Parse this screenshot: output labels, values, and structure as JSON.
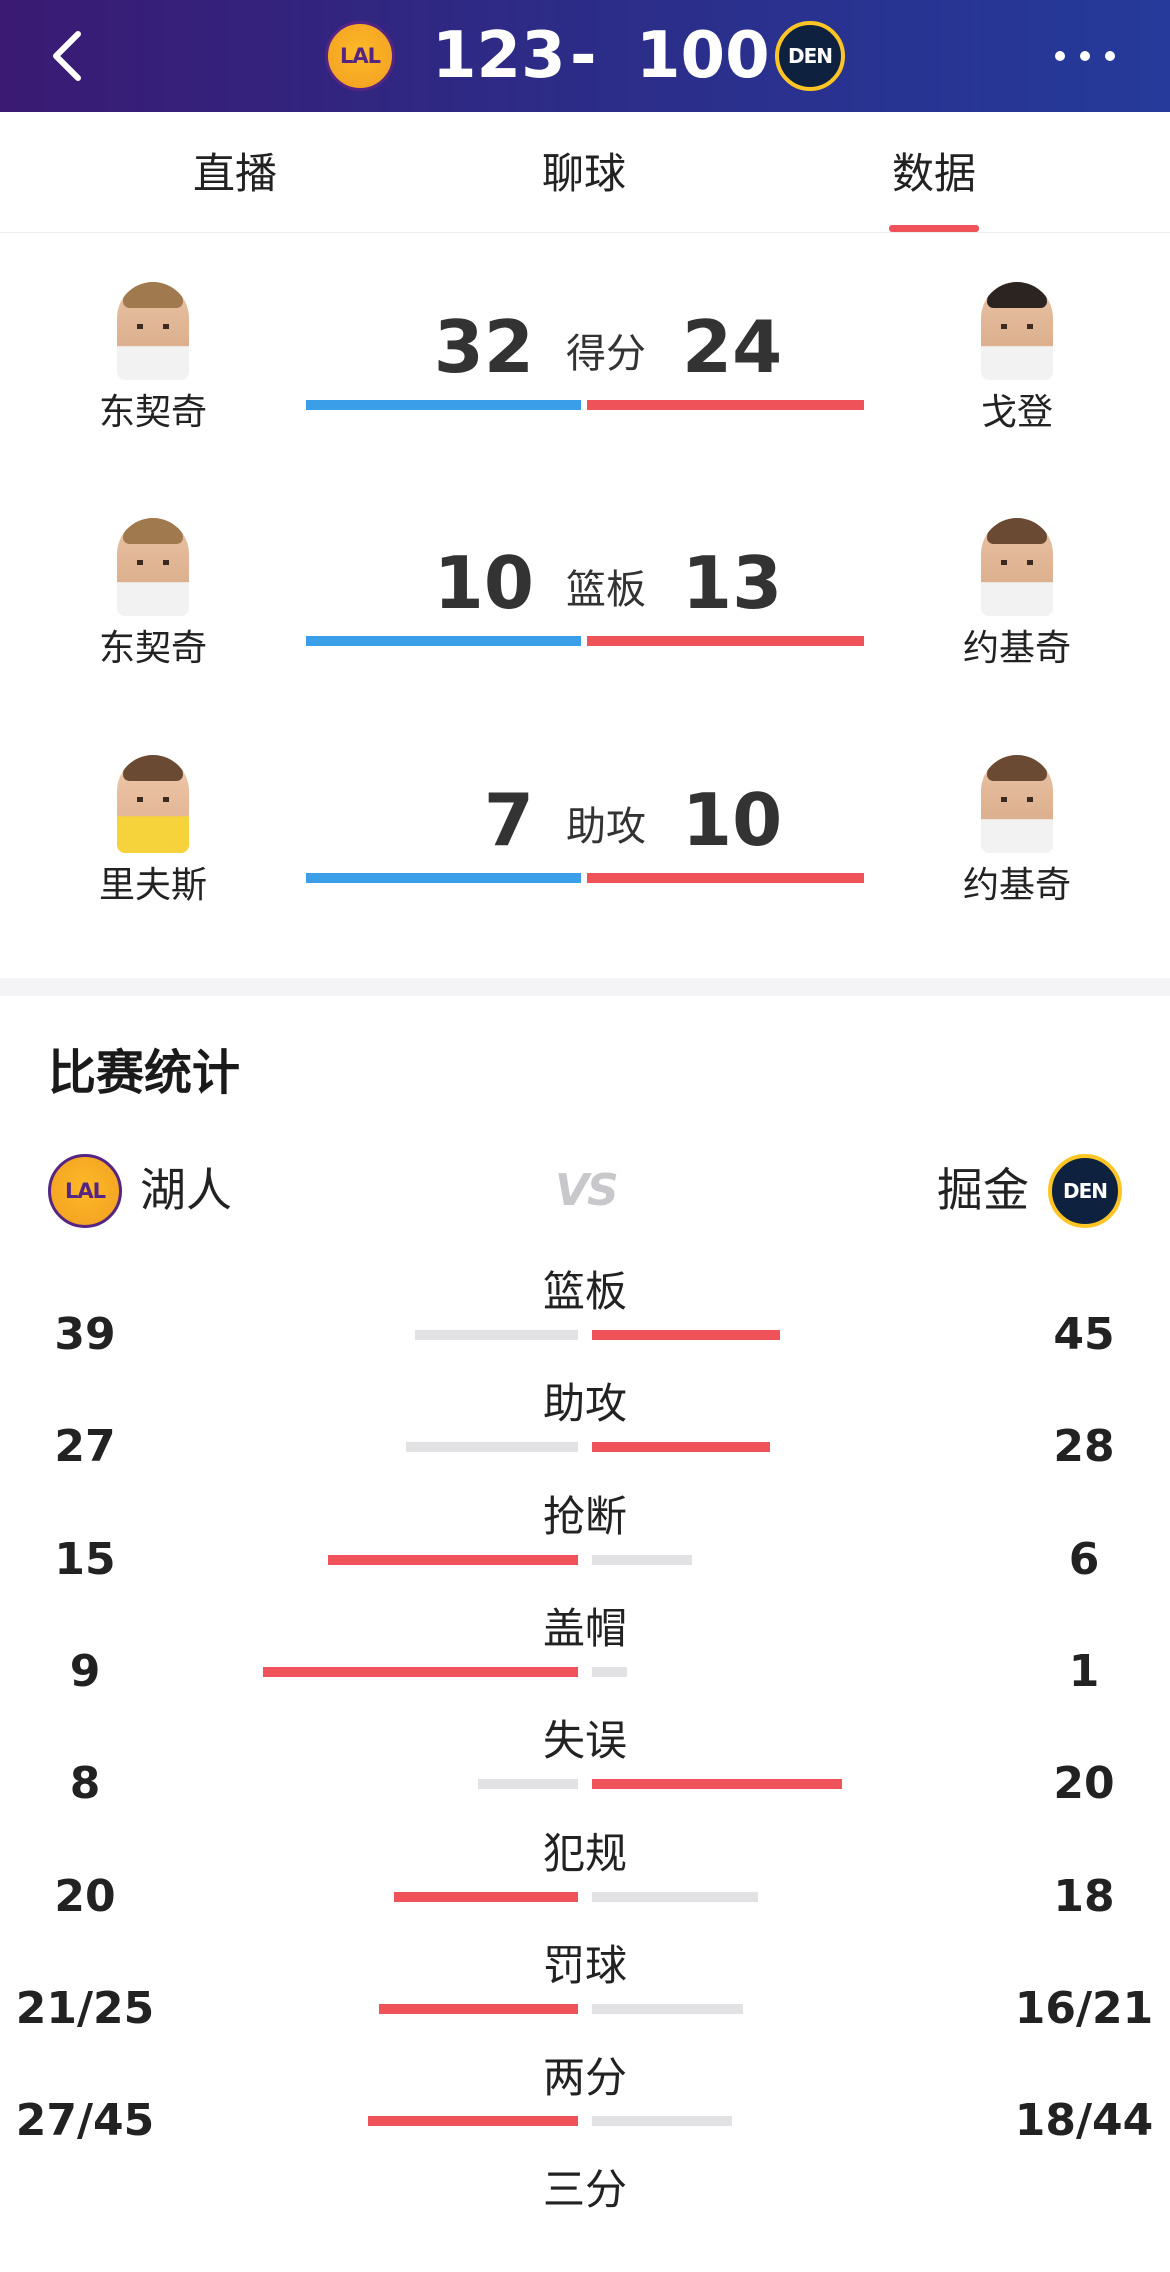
{
  "header": {
    "home_score": "123",
    "separator": "-",
    "away_score": "100",
    "home_logo_text": "LAL",
    "away_logo_text": "DEN"
  },
  "tabs": [
    {
      "label": "直播",
      "active": false
    },
    {
      "label": "聊球",
      "active": false
    },
    {
      "label": "数据",
      "active": true
    }
  ],
  "leaders": [
    {
      "category": "得分",
      "home_value": "32",
      "away_value": "24",
      "home_player": "东契奇",
      "away_player": "戈登"
    },
    {
      "category": "篮板",
      "home_value": "10",
      "away_value": "13",
      "home_player": "东契奇",
      "away_player": "约基奇"
    },
    {
      "category": "助攻",
      "home_value": "7",
      "away_value": "10",
      "home_player": "里夫斯",
      "away_player": "约基奇"
    }
  ],
  "game_stats": {
    "title": "比赛统计",
    "home_team": "湖人",
    "away_team": "掘金",
    "vs": "VS",
    "rows": [
      {
        "label": "篮板",
        "home": "39",
        "away": "45",
        "home_val": 39,
        "away_val": 45
      },
      {
        "label": "助攻",
        "home": "27",
        "away": "28",
        "home_val": 27,
        "away_val": 28
      },
      {
        "label": "抢断",
        "home": "15",
        "away": "6",
        "home_val": 15,
        "away_val": 6
      },
      {
        "label": "盖帽",
        "home": "9",
        "away": "1",
        "home_val": 9,
        "away_val": 1
      },
      {
        "label": "失误",
        "home": "8",
        "away": "20",
        "home_val": 8,
        "away_val": 20
      },
      {
        "label": "犯规",
        "home": "20",
        "away": "18",
        "home_val": 20,
        "away_val": 18
      },
      {
        "label": "罚球",
        "home": "21/25",
        "away": "16/21",
        "home_val": 21,
        "away_val": 16
      },
      {
        "label": "两分",
        "home": "27/45",
        "away": "18/44",
        "home_val": 27,
        "away_val": 18
      },
      {
        "label": "三分",
        "home": "",
        "away": "",
        "home_val": 0,
        "away_val": 0
      }
    ]
  },
  "colors": {
    "header_start": "#3a1a73",
    "header_end": "#253a9a",
    "home_bar": "#3a9ee8",
    "away_bar": "#f0525a",
    "leading_bar": "#f0525a",
    "trailing_bar": "#e2e2e4",
    "tab_indicator": "#f0525a"
  },
  "icons": {
    "back": "chevron-left-icon",
    "more": "more-dots-icon"
  }
}
